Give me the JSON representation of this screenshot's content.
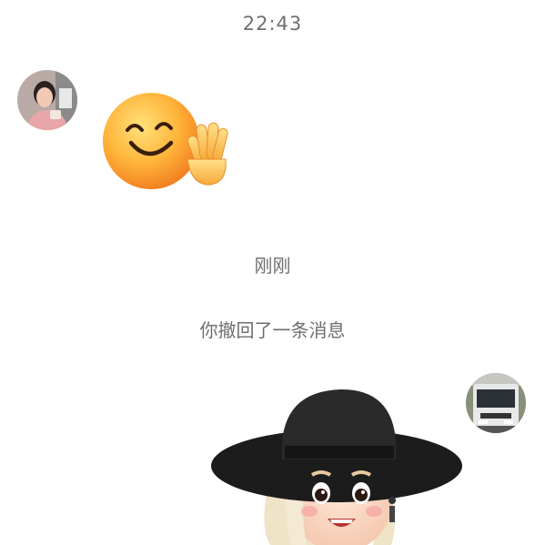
{
  "chat": {
    "timestamp": "22:43",
    "system_time": "刚刚",
    "recall_notice": "你撤回了一条消息"
  },
  "messages": [
    {
      "sender": "contact",
      "type": "sticker",
      "icon": "smile-wave-emoji"
    },
    {
      "sender": "self",
      "type": "sticker",
      "icon": "memoji-hat-girl"
    }
  ],
  "colors": {
    "background": "#ffffff",
    "system_text": "#6e6e6e"
  }
}
